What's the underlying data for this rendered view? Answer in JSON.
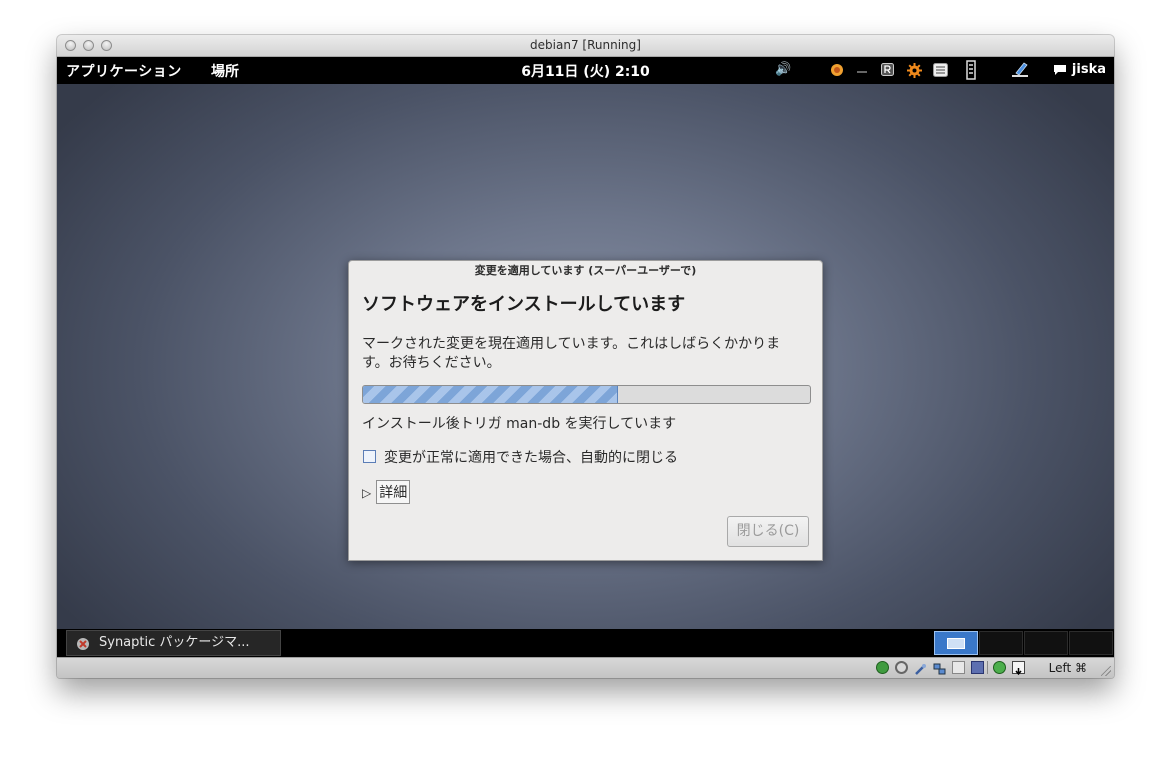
{
  "host_window": {
    "title": "debian7 [Running]"
  },
  "topbar": {
    "applications": "アプリケーション",
    "places": "場所",
    "clock": "6月11日 (火) 2:10",
    "volume_icon": "🔊",
    "user": "jiska"
  },
  "dialog": {
    "title": "変更を適用しています (スーパーユーザーで)",
    "heading": "ソフトウェアをインストールしています",
    "description": "マークされた変更を現在適用しています。これはしばらくかかります。お待ちください。",
    "progress_fraction": 0.57,
    "status": "インストール後トリガ man-db を実行しています",
    "auto_close_label": "変更が正常に適用できた場合、自動的に閉じる",
    "auto_close_checked": false,
    "details_label": "詳細",
    "close_button": "閉じる(C)"
  },
  "taskbar": {
    "task_label": "Synaptic パッケージマ..."
  },
  "host_statusbar": {
    "host_key": "Left ⌘"
  },
  "colors": {
    "accent_blue": "#7da5d8",
    "topbar_bg": "#000000"
  }
}
